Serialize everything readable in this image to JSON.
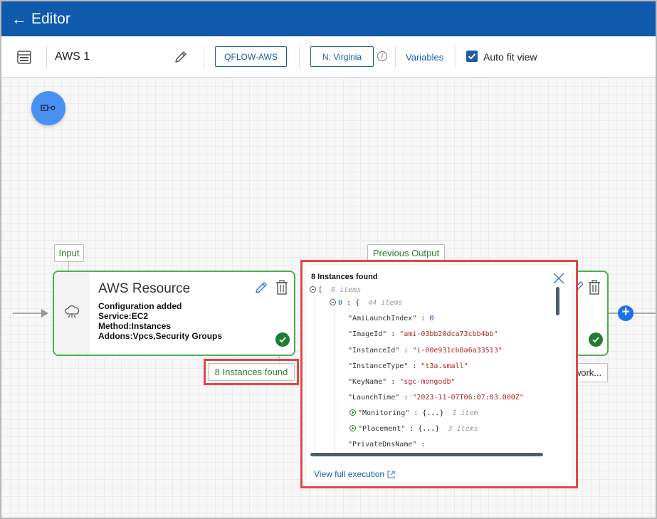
{
  "header": {
    "back_symbol": "←",
    "title": "Editor"
  },
  "toolbar": {
    "workflow_name": "AWS 1",
    "connection_label": "QFLOW-AWS",
    "region_label": "N. Virginia",
    "info_symbol": "i",
    "variables_label": "Variables",
    "autofit_label": "Auto fit view",
    "autofit_checked": true
  },
  "canvas": {
    "input_tag": "Input",
    "previous_output_tag": "Previous Output",
    "node": {
      "title": "AWS Resource",
      "lines": [
        "Configuration added",
        "Service:EC2",
        "Method:Instances",
        "Addons:Vpcs,Security Groups"
      ],
      "status": "success"
    },
    "output_badge": "8 Instances found",
    "right_node_tag": "work...",
    "add_symbol": "+"
  },
  "popup": {
    "title": "8 Instances found",
    "root_open": "[",
    "root_meta": "8 items",
    "item0_index": "0",
    "item0_open": "{",
    "item0_meta": "44 items",
    "fields": [
      {
        "key": "\"AmiLaunchIndex\"",
        "value": "0",
        "kind": "num"
      },
      {
        "key": "\"ImageId\"",
        "value": "\"ami-03bb20dca73cbb4bb\"",
        "kind": "str"
      },
      {
        "key": "\"InstanceId\"",
        "value": "\"i-00e931cb8a6a33513\"",
        "kind": "str"
      },
      {
        "key": "\"InstanceType\"",
        "value": "\"t3a.small\"",
        "kind": "str"
      },
      {
        "key": "\"KeyName\"",
        "value": "\"sgc-mongodb\"",
        "kind": "str"
      },
      {
        "key": "\"LaunchTime\"",
        "value": "\"2023-11-07T06:07:03.000Z\"",
        "kind": "str"
      }
    ],
    "collapsed": [
      {
        "key": "\"Monitoring\"",
        "open": "{",
        "dots": "...",
        "close": "}",
        "meta": "1 item"
      },
      {
        "key": "\"Placement\"",
        "open": "{",
        "dots": "...",
        "close": "}",
        "meta": "3 items"
      }
    ],
    "last_key": "\"PrivateDnsName\"",
    "link_label": "View full execution"
  }
}
